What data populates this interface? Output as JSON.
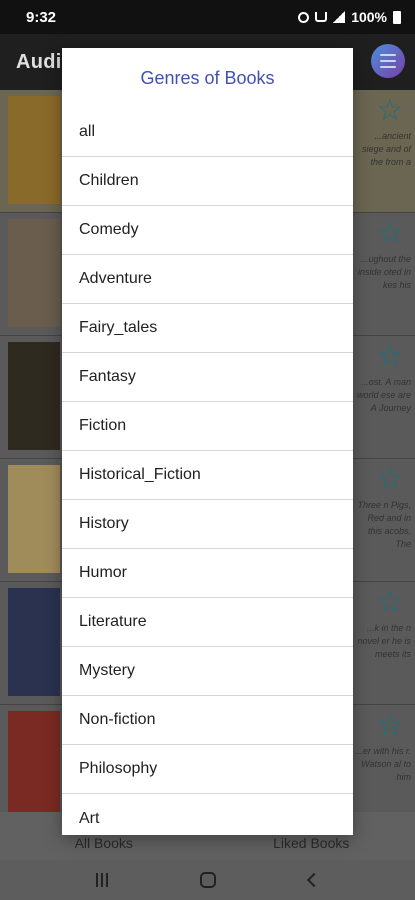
{
  "status_bar": {
    "time": "9:32",
    "battery": "100%"
  },
  "app": {
    "title": "Audiobooks"
  },
  "book_list": {
    "items": [
      {
        "cover_color": "#8a6a2a",
        "description": "...ancient siege and of the from a"
      },
      {
        "cover_color": "#6a5d4d",
        "description": "...ughout the inside oted in kes his"
      },
      {
        "cover_color": "#2e2a20",
        "description": "...ost. A man world ese are A Journey"
      },
      {
        "cover_color": "#a08b5a",
        "description": "Three n Pigs, Red and in this acobs. The"
      },
      {
        "cover_color": "#2b3250",
        "description": "...k in the n novel er he is meets its"
      },
      {
        "cover_color": "#7a2a22",
        "description": "...er with his r. Watson al to him"
      }
    ]
  },
  "bottom_tabs": {
    "all_books": "All Books",
    "liked_books": "Liked Books"
  },
  "dialog": {
    "title": "Genres of Books",
    "genres": [
      "all",
      "Children",
      "Comedy",
      "Adventure",
      "Fairy_tales",
      "Fantasy",
      "Fiction",
      "Historical_Fiction",
      "History",
      "Humor",
      "Literature",
      "Mystery",
      "Non-fiction",
      "Philosophy",
      "Art"
    ]
  },
  "colors": {
    "dialog_title": "#3f51b5",
    "star": "#1d6f7a",
    "scrim": "#5a5a5a"
  }
}
